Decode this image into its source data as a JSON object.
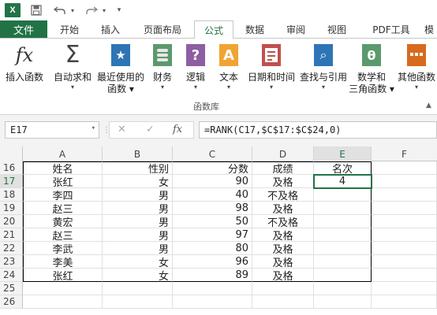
{
  "qat": {
    "excel_icon": "excel-logo",
    "save_icon": "save-icon",
    "undo_icon": "undo-icon",
    "redo_icon": "redo-icon",
    "customize_icon": "customize-qat-icon",
    "excel_letter": "X"
  },
  "tabs": {
    "file": "文件",
    "items": [
      "开始",
      "插入",
      "页面布局",
      "公式",
      "数据",
      "审阅",
      "视图",
      "PDF工具",
      "模"
    ],
    "active": "公式"
  },
  "ribbon": {
    "buttons": [
      {
        "label": "插入函数",
        "label2": "",
        "icon": "fx-icon"
      },
      {
        "label": "自动求和",
        "label2": "▾",
        "icon": "sigma-icon"
      },
      {
        "label": "最近使用的",
        "label2": "函数 ▾",
        "icon": "star-book-icon"
      },
      {
        "label": "财务",
        "label2": "▾",
        "icon": "finance-icon"
      },
      {
        "label": "逻辑",
        "label2": "▾",
        "icon": "logic-icon"
      },
      {
        "label": "文本",
        "label2": "▾",
        "icon": "text-icon"
      },
      {
        "label": "日期和时间",
        "label2": "▾",
        "icon": "calendar-icon"
      },
      {
        "label": "查找与引用",
        "label2": "▾",
        "icon": "lookup-icon"
      },
      {
        "label": "数学和",
        "label2": "三角函数 ▾",
        "icon": "math-icon"
      },
      {
        "label": "其他函数",
        "label2": "▾",
        "icon": "more-functions-icon"
      }
    ],
    "group_caption": "函数库",
    "fx_glyph": "fx",
    "sigma_glyph": "Σ",
    "star_glyph": "★",
    "logic_glyph": "?",
    "text_glyph": "A",
    "lookup_glyph": "⌕",
    "math_glyph": "θ",
    "colors": {
      "accent": "#217346",
      "blue_icon": "#2e75b6",
      "green_icon": "#5b9a6d",
      "purple_icon": "#8e5ea2",
      "orange_icon": "#f0a431",
      "red_icon": "#c0504d",
      "more_icon": "#d86a1e"
    }
  },
  "formula_bar": {
    "name_box": "E17",
    "cancel": "✕",
    "enter": "✓",
    "fx": "fx",
    "formula": "=RANK(C17,$C$17:$C$24,0)"
  },
  "sheet": {
    "columns": [
      "A",
      "B",
      "C",
      "D",
      "E",
      "F"
    ],
    "rows": [
      "16",
      "17",
      "18",
      "19",
      "20",
      "21",
      "22",
      "23",
      "24",
      "25",
      "26"
    ],
    "header_row": {
      "A": "姓名",
      "B": "性别",
      "C": "分数",
      "D": "成绩",
      "E": "名次"
    },
    "data": [
      {
        "A": "张红",
        "B": "女",
        "C": "90",
        "D": "及格",
        "E": "4"
      },
      {
        "A": "李四",
        "B": "男",
        "C": "40",
        "D": "不及格",
        "E": ""
      },
      {
        "A": "赵三",
        "B": "男",
        "C": "98",
        "D": "及格",
        "E": ""
      },
      {
        "A": "黄宏",
        "B": "男",
        "C": "50",
        "D": "不及格",
        "E": ""
      },
      {
        "A": "赵三",
        "B": "男",
        "C": "97",
        "D": "及格",
        "E": ""
      },
      {
        "A": "李武",
        "B": "男",
        "C": "80",
        "D": "及格",
        "E": ""
      },
      {
        "A": "李美",
        "B": "女",
        "C": "96",
        "D": "及格",
        "E": ""
      },
      {
        "A": "张红",
        "B": "女",
        "C": "89",
        "D": "及格",
        "E": ""
      }
    ],
    "selected_cell": "E17"
  }
}
